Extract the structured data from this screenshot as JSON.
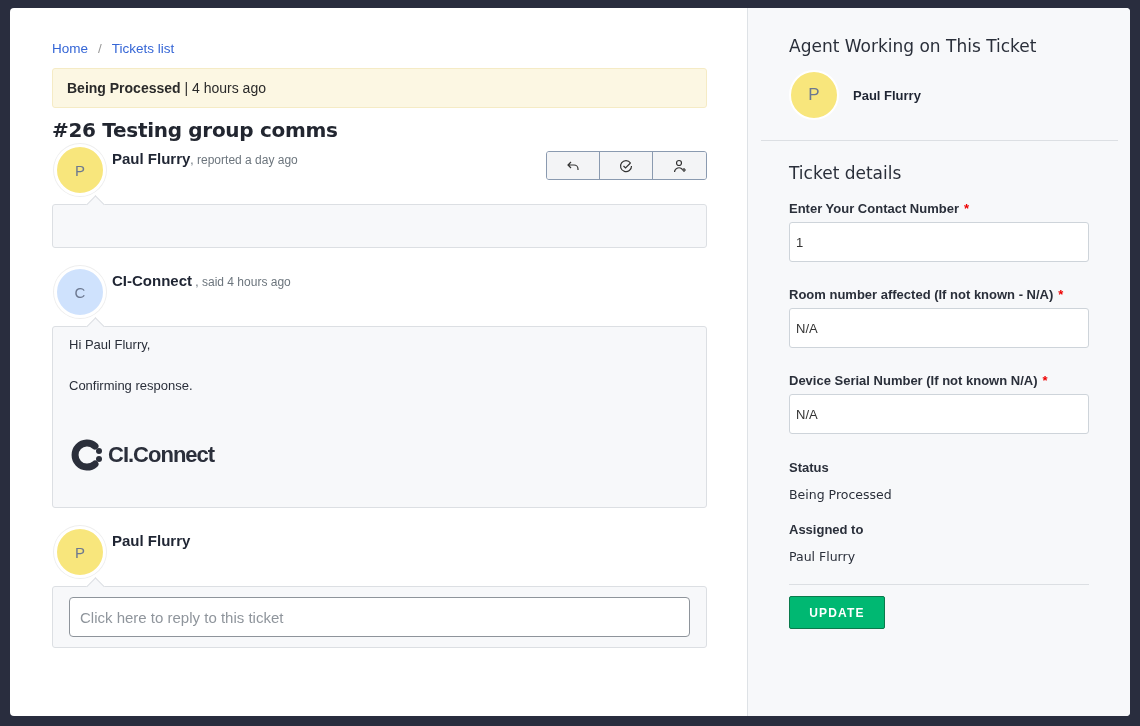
{
  "breadcrumb": {
    "items": [
      {
        "label": "Home"
      },
      {
        "label": "Tickets list"
      }
    ],
    "separator": "/"
  },
  "status_banner": {
    "status": "Being Processed",
    "separator": "|",
    "time": "4 hours ago"
  },
  "ticket_title": "#26 Testing group comms",
  "messages": [
    {
      "kind": "report",
      "avatar_letter": "P",
      "color": "#f8e67c",
      "author": "Paul Flurry",
      "meta": ", reported a day ago",
      "actions": true
    },
    {
      "kind": "reply",
      "avatar_letter": "C",
      "color": "#cfe2fd",
      "author": "CI-Connect",
      "meta": " , said 4 hours ago",
      "body": [
        "Hi Paul Flurry,",
        "Confirming response."
      ],
      "logo_text": "CI.Connect"
    },
    {
      "kind": "compose",
      "avatar_letter": "P",
      "color": "#f8e67c",
      "author": "Paul Flurry",
      "placeholder": "Click here to reply to this ticket"
    }
  ],
  "agent_panel": {
    "title": "Agent Working on This Ticket",
    "avatar_letter": "P",
    "name": "Paul Flurry"
  },
  "details": {
    "title": "Ticket details",
    "fields": [
      {
        "label": "Enter Your Contact Number",
        "required_mark": "*",
        "value": "1"
      },
      {
        "label": "Room number affected (If not known - N/A)",
        "required_mark": "*",
        "value": "N/A"
      },
      {
        "label": "Device Serial Number (If not known N/A)",
        "required_mark": "*",
        "value": "N/A"
      }
    ],
    "info": [
      {
        "label": "Status",
        "value": "Being Processed"
      },
      {
        "label": "Assigned to",
        "value": "Paul Flurry"
      }
    ],
    "button": "UPDATE"
  }
}
